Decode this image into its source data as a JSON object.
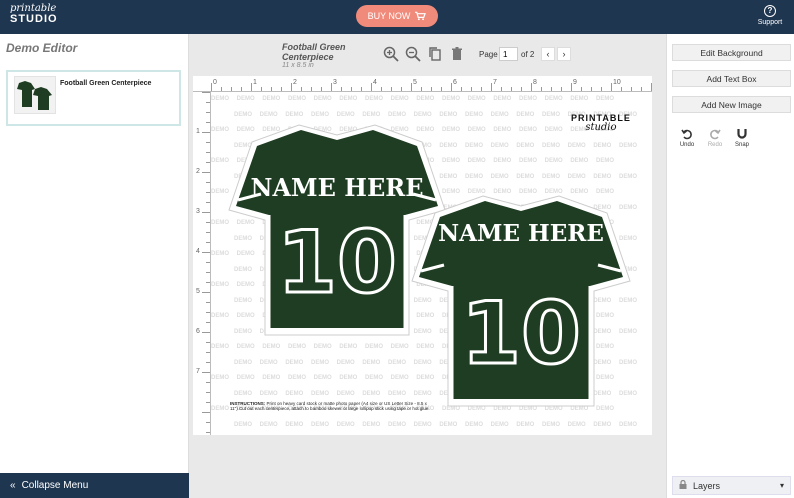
{
  "header": {
    "logo_line1": "printable",
    "logo_line2": "STUDIO",
    "buy_label": "BUY NOW",
    "support_label": "Support"
  },
  "left_panel": {
    "title": "Demo Editor",
    "projects": [
      {
        "name": "Football Green Centerpiece"
      }
    ],
    "collapse_label": "Collapse Menu"
  },
  "toolbar": {
    "doc_title": "Football Green Centerpiece",
    "doc_size": "11 x 8.5 in",
    "page_label": "Page",
    "page_value": "1",
    "page_of": "of 2"
  },
  "canvas": {
    "ruler_top": [
      "0",
      "1",
      "2",
      "3",
      "4",
      "5",
      "6",
      "7",
      "8",
      "9",
      "10"
    ],
    "ruler_left": [
      "1",
      "2",
      "3",
      "4",
      "5",
      "6",
      "7"
    ],
    "watermark": "DEMO",
    "brand_line1": "PRINTABLE",
    "brand_line2": "studio",
    "jersey_name": "NAME HERE",
    "jersey_number": "10",
    "jersey_color": "#1f3d22",
    "instructions_label": "INSTRUCTIONS:",
    "instructions_text": "Print on heavy card stock or matte photo paper (A4 size or US Letter Size - 8.5 x 11\") Cut out each centerpiece, attach to bamboo skewer or large lollipop stick using tape or hot glue."
  },
  "right_panel": {
    "edit_background": "Edit Background",
    "add_text_box": "Add Text Box",
    "add_new_image": "Add New Image",
    "undo": "Undo",
    "redo": "Redo",
    "snap": "Snap",
    "layers": "Layers"
  },
  "colors": {
    "navy": "#1f3650",
    "buy_button": "#f08b7c",
    "jersey_green": "#1f3d22"
  }
}
